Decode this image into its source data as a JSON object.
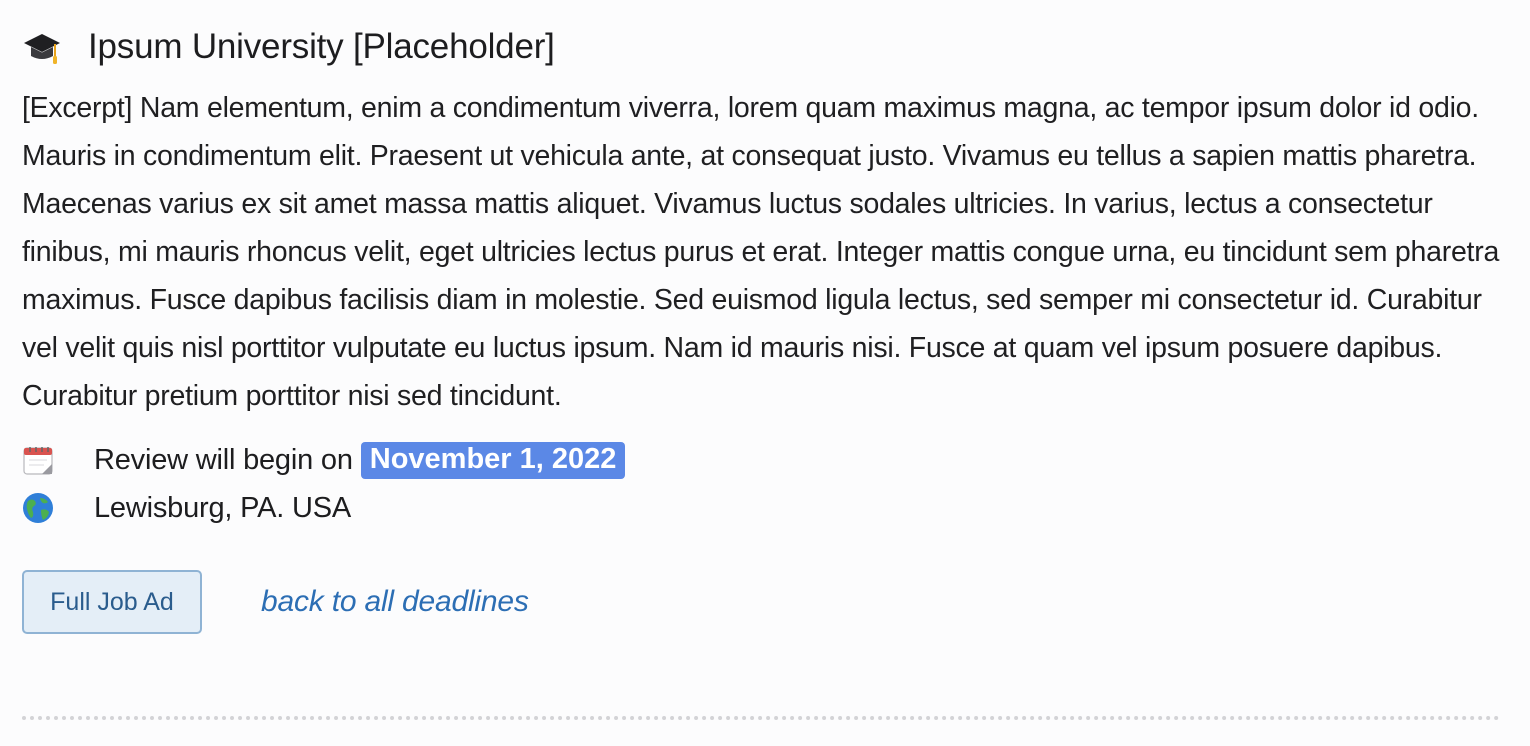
{
  "job": {
    "title": "Ipsum University [Placeholder]",
    "excerpt": "[Excerpt] Nam elementum, enim a condimentum viverra, lorem quam maximus magna, ac tempor ipsum dolor id odio. Mauris in condimentum elit. Praesent ut vehicula ante, at consequat justo. Vivamus eu tellus a sapien mattis pharetra. Maecenas varius ex sit amet massa mattis aliquet. Vivamus luctus sodales ultricies. In varius, lectus a consectetur finibus, mi mauris rhoncus velit, eget ultricies lectus purus et erat. Integer mattis congue urna, eu tincidunt sem pharetra maximus. Fusce dapibus facilisis diam in molestie. Sed euismod ligula lectus, sed semper mi consectetur id. Curabitur vel velit quis nisl porttitor vulputate eu luctus ipsum. Nam id mauris nisi. Fusce at quam vel ipsum posuere dapibus. Curabitur pretium porttitor nisi sed tincidunt.",
    "review_prefix": "Review will begin on",
    "review_date": "November 1, 2022",
    "location": "Lewisburg, PA. USA"
  },
  "actions": {
    "full_job_ad_label": "Full Job Ad",
    "back_link_label": "back to all deadlines"
  },
  "icons": {
    "title": "graduation-cap-icon",
    "date": "calendar-icon",
    "location": "globe-icon"
  },
  "colors": {
    "date_badge": "#5b88e6",
    "link": "#2c6eb4",
    "button_bg": "#e4eef7",
    "button_border": "#8fb3d4"
  }
}
